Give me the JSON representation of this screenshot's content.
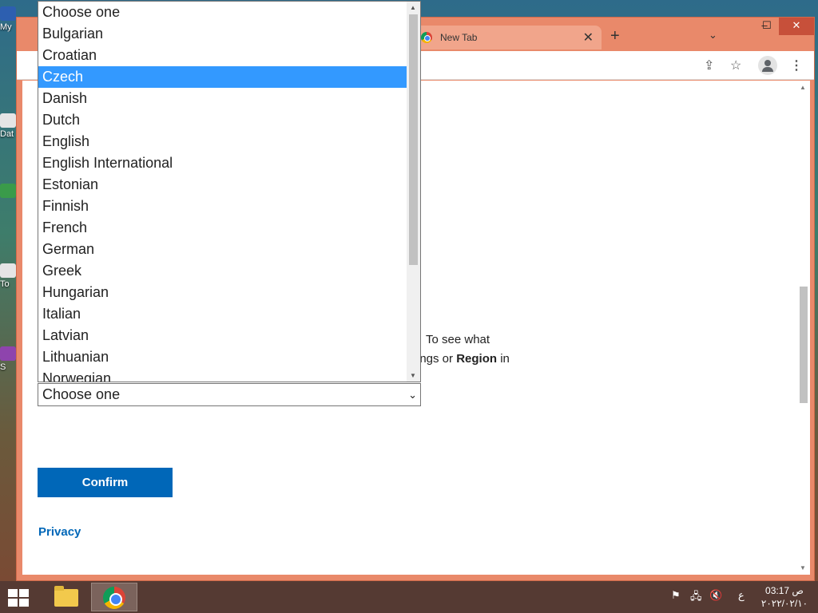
{
  "desktop": {
    "icons": [
      {
        "label": "My",
        "color": "#2d5fb0"
      },
      {
        "label": "Dat",
        "color": "#e5e5e5"
      },
      {
        "label": "",
        "color": "#3a9b4a"
      },
      {
        "label": "To",
        "color": "#e5e5e5"
      },
      {
        "label": "S",
        "color": "#8e44ad"
      }
    ]
  },
  "browser": {
    "tab_title": "New Tab",
    "icons": {
      "tab_favicon": "chrome-icon",
      "tab_close": "close-icon",
      "new_tab": "plus-icon",
      "tab_search": "chevron-down-icon",
      "share": "share-icon",
      "bookmark": "star-icon",
      "profile": "profile-icon",
      "menu": "kebab-menu-icon"
    },
    "window_controls": {
      "minimize": "–",
      "maximize": "☐",
      "close": "✕"
    }
  },
  "page": {
    "text_line1": "To see what",
    "text_line2_pre": "ings or ",
    "text_line2_bold": "Region",
    "text_line2_post": " in",
    "confirm_label": "Confirm",
    "privacy_label": "Privacy"
  },
  "language_select": {
    "value": "Choose one",
    "selected_option": "Czech",
    "options": [
      "Choose one",
      "Bulgarian",
      "Croatian",
      "Czech",
      "Danish",
      "Dutch",
      "English",
      "English International",
      "Estonian",
      "Finnish",
      "French",
      "German",
      "Greek",
      "Hungarian",
      "Italian",
      "Latvian",
      "Lithuanian",
      "Norwegian"
    ]
  },
  "taskbar": {
    "apps": [
      "file-explorer-icon",
      "chrome-icon"
    ],
    "tray": {
      "lang": "ع",
      "time": "03:17 ص",
      "date": "٢٠٢٢/٠٢/١٠"
    }
  },
  "colors": {
    "accent": "#0067b8",
    "selection": "#3399ff",
    "window_frame": "#e9896a"
  }
}
